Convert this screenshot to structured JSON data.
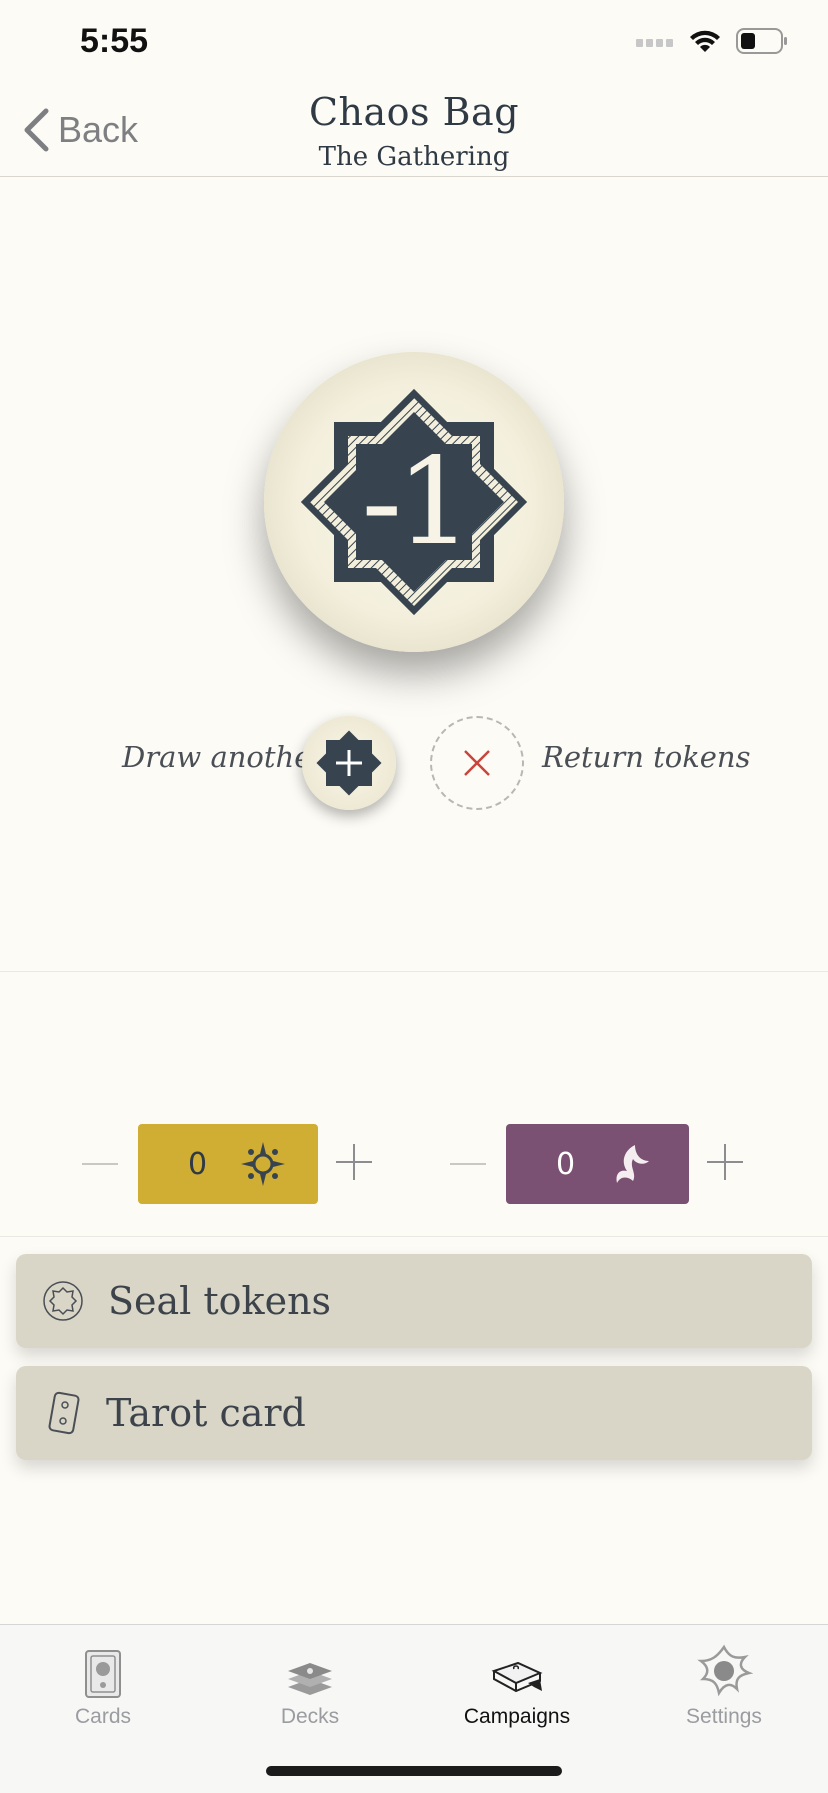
{
  "status": {
    "time": "5:55"
  },
  "nav": {
    "back_label": "Back",
    "title": "Chaos Bag",
    "subtitle": "The Gathering"
  },
  "token": {
    "value": "-1"
  },
  "actions": {
    "draw_label": "Draw another",
    "return_label": "Return tokens"
  },
  "counters": [
    {
      "value": "0",
      "color": "#cfae33",
      "icon": "bless-icon"
    },
    {
      "value": "0",
      "color": "#7a5073",
      "icon": "curse-icon"
    }
  ],
  "rows": [
    {
      "label": "Seal tokens",
      "icon": "seal-icon"
    },
    {
      "label": "Tarot card",
      "icon": "tarot-card-icon"
    }
  ],
  "tabs": [
    {
      "label": "Cards",
      "icon": "cards-icon"
    },
    {
      "label": "Decks",
      "icon": "decks-icon"
    },
    {
      "label": "Campaigns",
      "icon": "campaigns-icon",
      "active": true
    },
    {
      "label": "Settings",
      "icon": "settings-icon"
    }
  ]
}
